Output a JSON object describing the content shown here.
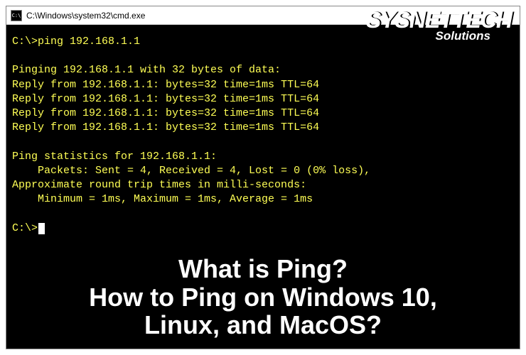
{
  "window": {
    "title": "C:\\Windows\\system32\\cmd.exe",
    "icon_label": "C:\\"
  },
  "terminal": {
    "prompt1": "C:\\>",
    "command": "ping 192.168.1.1",
    "pinging_header": "Pinging 192.168.1.1 with 32 bytes of data:",
    "replies": [
      "Reply from 192.168.1.1: bytes=32 time=1ms TTL=64",
      "Reply from 192.168.1.1: bytes=32 time=1ms TTL=64",
      "Reply from 192.168.1.1: bytes=32 time=1ms TTL=64",
      "Reply from 192.168.1.1: bytes=32 time=1ms TTL=64"
    ],
    "stats_header": "Ping statistics for 192.168.1.1:",
    "packets_line": "    Packets: Sent = 4, Received = 4, Lost = 0 (0% loss),",
    "rtt_header": "Approximate round trip times in milli-seconds:",
    "rtt_line": "    Minimum = 1ms, Maximum = 1ms, Average = 1ms",
    "prompt2": "C:\\>"
  },
  "watermark": {
    "main": "SYSNETTECH",
    "sub": "Solutions"
  },
  "overlay": {
    "line1": "What is Ping?",
    "line2": "How to Ping on Windows 10,",
    "line3": "Linux, and MacOS?"
  }
}
